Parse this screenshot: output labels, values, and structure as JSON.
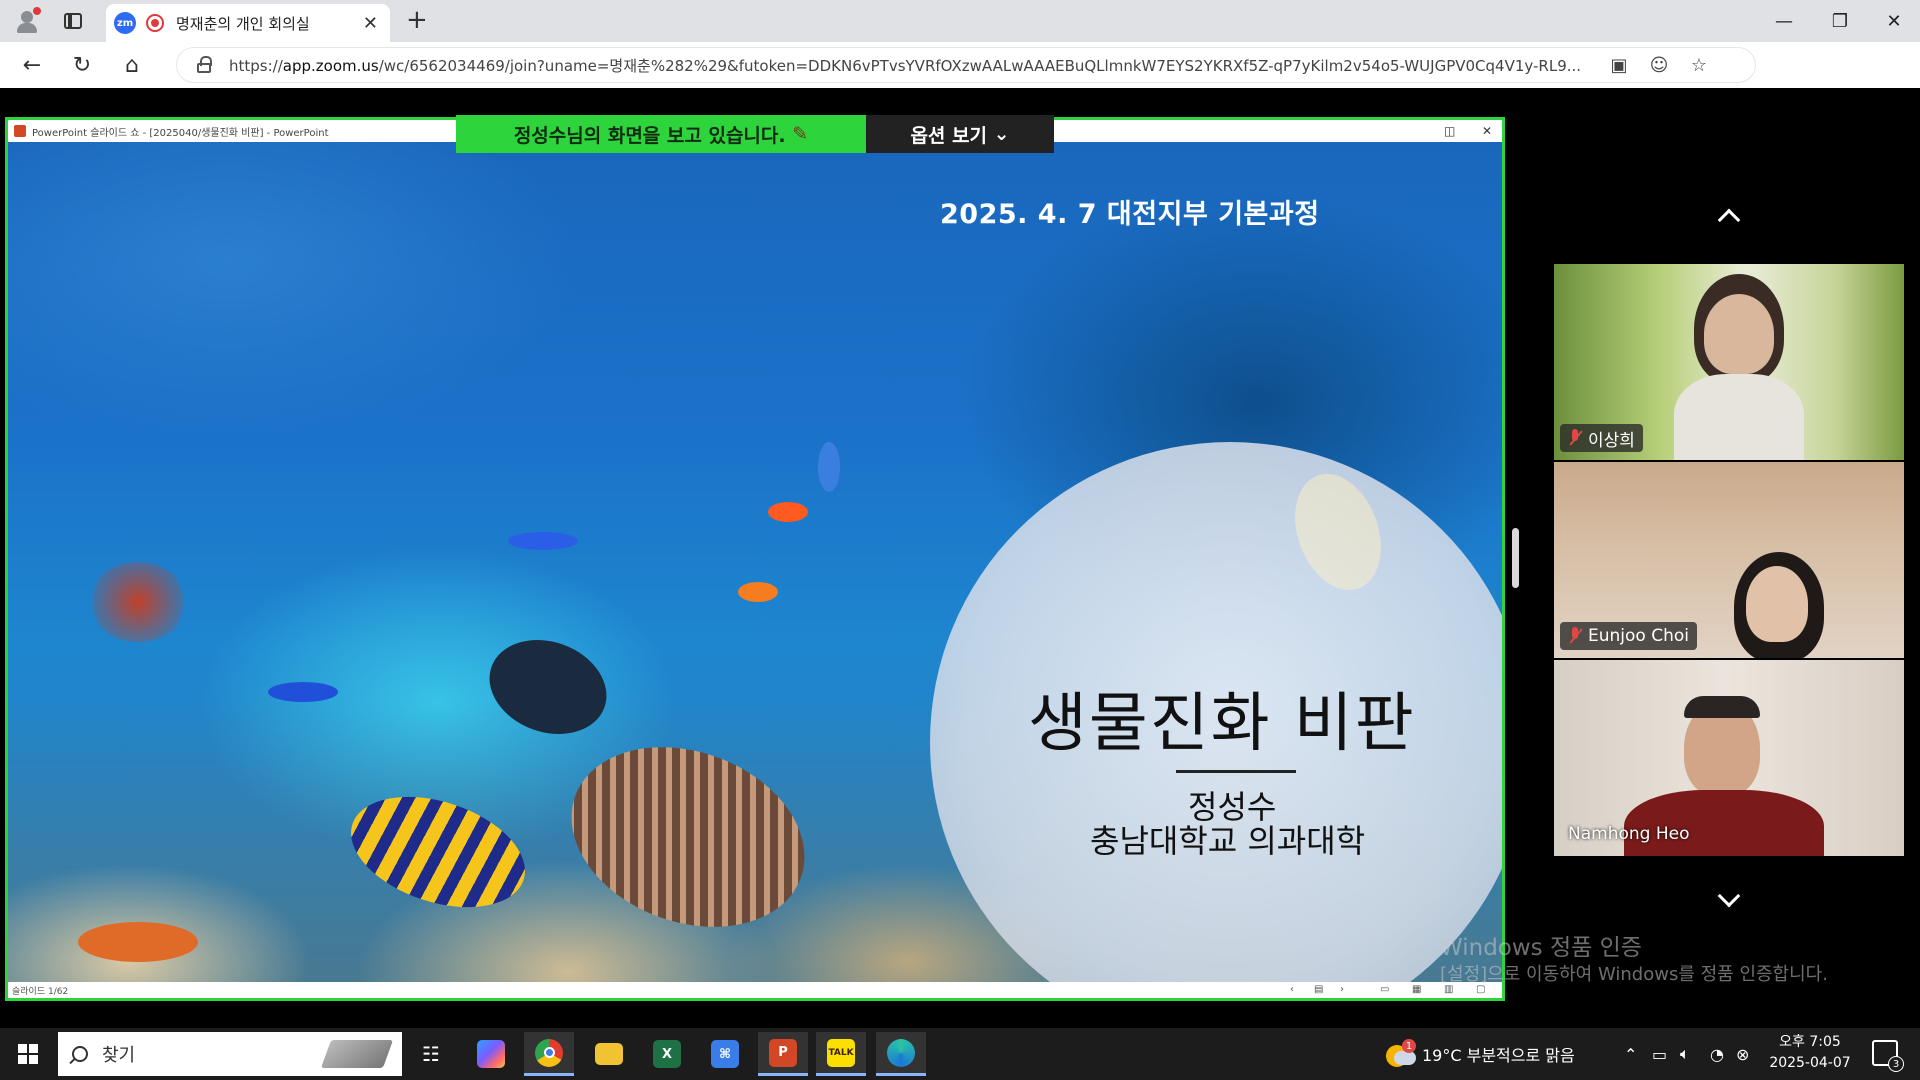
{
  "browser": {
    "tab_title": "명재춘의 개인 회의실",
    "tab_icon_text": "zm",
    "url_prefix": "https://",
    "url_host": "app.zoom.us",
    "url_rest": "/wc/6562034469/join?uname=명재춘%282%29&futoken=DDKN6vPTvsYVRfOXzwAALwAAAEBuQLlmnkW7EYS2YKRXf5Z-qP7yKilm2v54o5-WUJGPV0Cq4V1y-RL9..."
  },
  "share": {
    "banner": "정성수님의 화면을 보고 있습니다.",
    "options_label": "옵션 보기",
    "ppt_title": "PowerPoint 슬라이드 쇼 - [2025040/생물진화 비판] - PowerPoint",
    "slide_counter": "슬라이드 1/62"
  },
  "slide": {
    "date_line": "2025. 4. 7 대전지부 기본과정",
    "title": "생물진화 비판",
    "author": "정성수",
    "affiliation": "충남대학교 의과대학"
  },
  "participants": [
    {
      "name": "이상희",
      "muted": true
    },
    {
      "name": "Eunjoo Choi",
      "muted": true
    },
    {
      "name": "Namhong Heo",
      "muted": false
    }
  ],
  "watermark": {
    "line1": "Windows 정품 인증",
    "line2": "[설정]으로 이동하여 Windows를 정품 인증합니다."
  },
  "taskbar": {
    "search_placeholder": "찾기",
    "weather": "19°C  부분적으로 맑음",
    "time": "오후 7:05",
    "date": "2025-04-07",
    "notification_count": "3",
    "weather_badge": "1",
    "apps": [
      "task-view",
      "copilot",
      "chrome",
      "file-explorer",
      "excel",
      "remote",
      "powerpoint",
      "kakaotalk",
      "edge"
    ]
  },
  "colors": {
    "share_border": "#2ed43c",
    "muted": "#e04848",
    "accent": "#2d6bf6"
  }
}
